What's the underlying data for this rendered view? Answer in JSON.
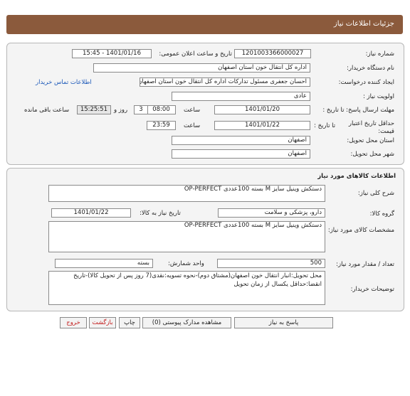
{
  "header": {
    "title": "جزئیات اطلاعات نیاز"
  },
  "info": {
    "need_number_label": "شماره نیاز:",
    "need_number": "1201003366000027",
    "announce_label": "تاریخ و ساعت اعلان عمومی:",
    "announce_value": "1401/01/16 - 15:45",
    "buyer_org_label": "نام دستگاه خریدار:",
    "buyer_org": "اداره کل انتقال خون استان اصفهان",
    "requester_label": "ایجاد کننده درخواست:",
    "requester": "احسان جعفری مسئول تدارکات اداره کل انتقال خون استان اصفهان",
    "contact_link": "اطلاعات تماس خریدار",
    "priority_label": "اولویت نیاز :",
    "priority": "عادی",
    "deadline_label": "مهلت ارسال پاسخ: تا تاریخ :",
    "deadline_date": "1401/01/20",
    "time_label": "ساعت",
    "deadline_time": "08:00",
    "days_value": "3",
    "days_label": "روز و",
    "remaining_time": "15:25:51",
    "remaining_label": "ساعت باقی مانده",
    "validity_label": "حداقل تاریخ اعتبار",
    "validity_label2": "قیمت:",
    "validity_until": "تا تاریخ :",
    "validity_date": "1401/01/22",
    "validity_time": "23:59",
    "province_label": "استان محل تحویل:",
    "province": "اصفهان",
    "city_label": "شهر محل تحویل:",
    "city": "اصفهان"
  },
  "goods": {
    "title": "اطلاعات کالاهای مورد نیاز",
    "summary_label": "شرح کلی نیاز:",
    "summary": "دستکش وینیل سایز M بسته 100عددی  OP-PERFECT",
    "group_label": "گروه کالا:",
    "group": "دارو، پزشکی و سلامت",
    "need_date_label": "تاریخ نیاز به کالا:",
    "need_date": "1401/01/22",
    "spec_label": "مشخصات کالای مورد نیاز:",
    "spec": "دستکش وینیل سایز M بسته 100عددی  OP-PERFECT",
    "qty_label": "تعداد / مقدار مورد نیاز:",
    "qty": "500",
    "unit_label": "واحد شمارش:",
    "unit": "بسته",
    "desc_label": "توضیحات خریدار:",
    "desc": "محل تحویل:انبار انتقال خون اصفهان(مشتاق دوم)-نحوه تسویه:نقدی(7 روز پس از تحویل کالا)-تاریخ انقضا:حداقل یکسال از زمان تحویل"
  },
  "footer": {
    "reply": "پاسخ به نیاز",
    "attachments": "مشاهده مدارک پیوستی (0)",
    "print": "چاپ",
    "back": "بازگشت",
    "exit": "خروج"
  }
}
